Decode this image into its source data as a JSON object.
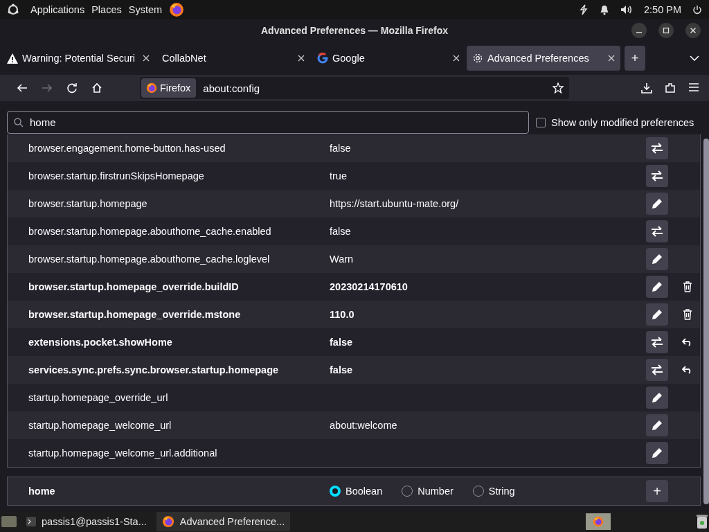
{
  "top_panel": {
    "menus": [
      "Applications",
      "Places",
      "System"
    ],
    "clock": "2:50 PM"
  },
  "window": {
    "title": "Advanced Preferences — Mozilla Firefox"
  },
  "tabs": [
    {
      "label": "Warning: Potential Securi",
      "kind": "warning",
      "selected": false
    },
    {
      "label": "CollabNet",
      "kind": "plain",
      "selected": false
    },
    {
      "label": "Google",
      "kind": "google",
      "selected": false
    },
    {
      "label": "Advanced Preferences",
      "kind": "settings",
      "selected": true
    }
  ],
  "new_tab_button": "+",
  "address_bar": {
    "identity": "Firefox",
    "url": "about:config"
  },
  "search": {
    "value": "home"
  },
  "show_modified": {
    "label": "Show only modified preferences",
    "checked": false
  },
  "preferences": [
    {
      "name": "browser.engagement.home-button.has-used",
      "value": "false",
      "modified": false,
      "kind": "toggle"
    },
    {
      "name": "browser.startup.firstrunSkipsHomepage",
      "value": "true",
      "modified": false,
      "kind": "toggle"
    },
    {
      "name": "browser.startup.homepage",
      "value": "https://start.ubuntu-mate.org/",
      "modified": false,
      "kind": "edit"
    },
    {
      "name": "browser.startup.homepage.abouthome_cache.enabled",
      "value": "false",
      "modified": false,
      "kind": "toggle"
    },
    {
      "name": "browser.startup.homepage.abouthome_cache.loglevel",
      "value": "Warn",
      "modified": false,
      "kind": "edit"
    },
    {
      "name": "browser.startup.homepage_override.buildID",
      "value": "20230214170610",
      "modified": true,
      "kind": "added"
    },
    {
      "name": "browser.startup.homepage_override.mstone",
      "value": "110.0",
      "modified": true,
      "kind": "added"
    },
    {
      "name": "extensions.pocket.showHome",
      "value": "false",
      "modified": true,
      "kind": "reset"
    },
    {
      "name": "services.sync.prefs.sync.browser.startup.homepage",
      "value": "false",
      "modified": true,
      "kind": "reset"
    },
    {
      "name": "startup.homepage_override_url",
      "modified": false,
      "kind": "edit"
    },
    {
      "name": "startup.homepage_welcome_url",
      "value": "about:welcome",
      "modified": false,
      "kind": "edit"
    },
    {
      "name": "startup.homepage_welcome_url.additional",
      "modified": false,
      "kind": "edit"
    }
  ],
  "add_row": {
    "name": "home",
    "types": [
      {
        "label": "Boolean",
        "selected": true
      },
      {
        "label": "Number",
        "selected": false
      },
      {
        "label": "String",
        "selected": false
      }
    ],
    "button": "+"
  },
  "taskbar": {
    "items": [
      "passis1@passis1-Sta...",
      "Advanced Preference..."
    ]
  }
}
